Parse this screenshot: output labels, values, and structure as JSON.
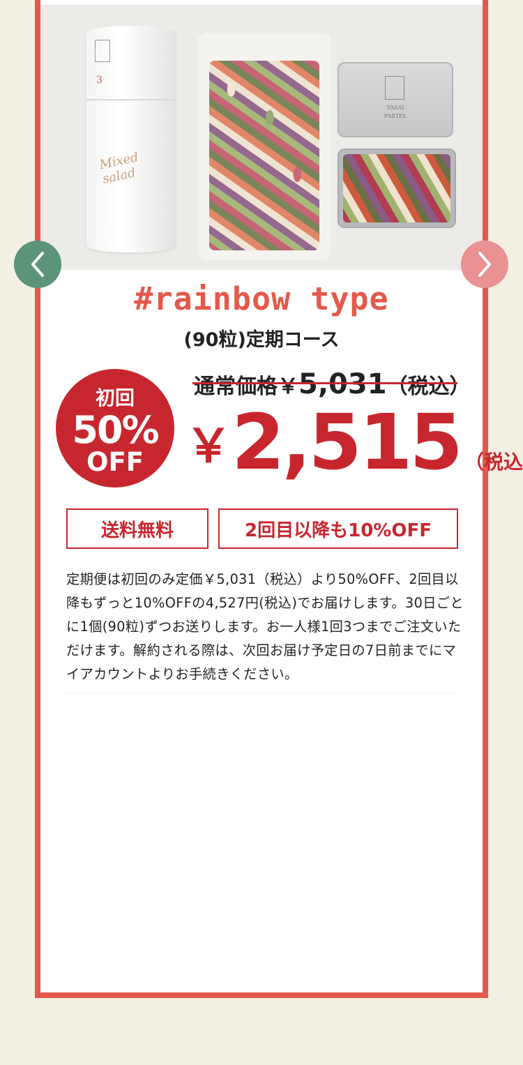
{
  "product": {
    "canister_number": "3",
    "canister_script": "Mixed salad",
    "tin_brand_line1": "YASAI",
    "tin_brand_line2": "PASTEL"
  },
  "carousel": {
    "prev_icon": "chevron-left-icon",
    "next_icon": "chevron-right-icon",
    "prev_color": "#5c947a",
    "next_color": "#e99193"
  },
  "heading": {
    "title": "#rainbow type",
    "subtitle": "(90粒)定期コース"
  },
  "badge": {
    "line1": "初回",
    "line2": "50%",
    "line3": "OFF"
  },
  "pricing": {
    "regular_label": "通常価格￥",
    "regular_value": "5,031",
    "regular_tax": "（税込）",
    "yen_symbol": "￥",
    "sale_value": "2,515",
    "sale_tax": "（税込）"
  },
  "tags": {
    "shipping": "送料無料",
    "discount": "2回目以降も10%OFF"
  },
  "description": "定期便は初回のみ定価￥5,031（税込）より50%OFF、2回目以降もずっと10%OFFの4,527円(税込)でお届けします。30日ごとに1個(90粒)ずつお送りします。お一人様1回3つまでご注文いただけます。解約される際は、次回お届け予定日の7日前までにマイアカウントよりお手続きください。",
  "colors": {
    "accent": "#e4594a",
    "price_red": "#c8262e",
    "background": "#f3f0e3"
  }
}
